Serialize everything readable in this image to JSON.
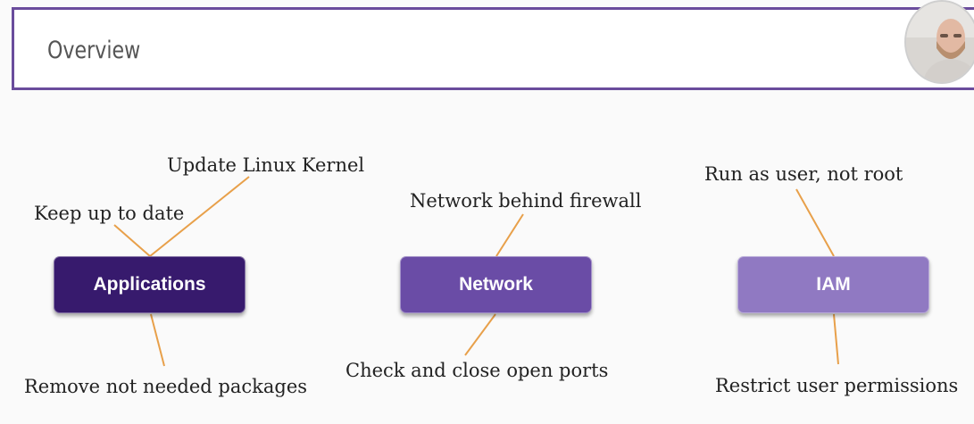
{
  "header": {
    "title": "Overview"
  },
  "colors": {
    "frame": "#6a4c9c",
    "applications": "#371a6d",
    "network": "#6a4ca6",
    "iam": "#9079c2",
    "connector": "#e8a04a"
  },
  "nodes": [
    {
      "label": "Applications"
    },
    {
      "label": "Network"
    },
    {
      "label": "IAM"
    }
  ],
  "notes": {
    "update_kernel": "Update Linux Kernel",
    "keep_up_to_date": "Keep up to date",
    "remove_packages": "Remove not needed packages",
    "network_firewall": "Network behind firewall",
    "close_ports": "Check and close open ports",
    "run_as_user": "Run as user, not root",
    "restrict_permissions": "Restrict user permissions"
  }
}
